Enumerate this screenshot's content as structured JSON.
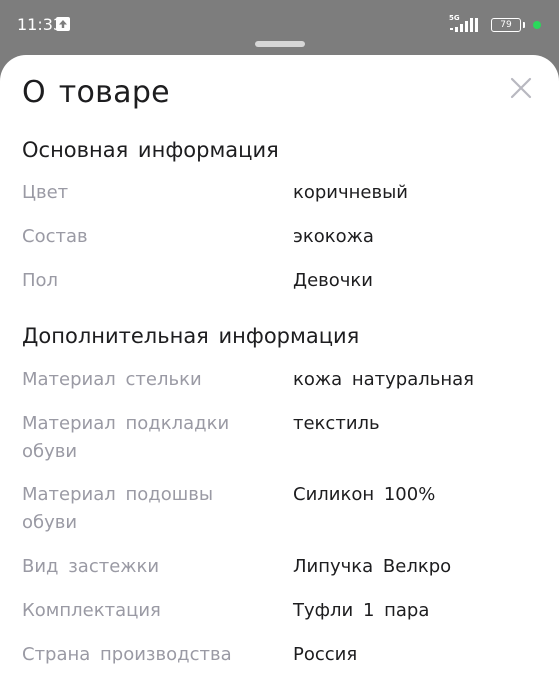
{
  "status_bar": {
    "time": "11:33",
    "network": "5G",
    "battery": "79"
  },
  "sheet": {
    "title": "О товаре",
    "sections": [
      {
        "heading": "Основная информация",
        "rows": [
          {
            "label": "Цвет",
            "value": "коричневый"
          },
          {
            "label": "Состав",
            "value": "экокожа"
          },
          {
            "label": "Пол",
            "value": "Девочки"
          }
        ]
      },
      {
        "heading": "Дополнительная информация",
        "rows": [
          {
            "label": "Материал стельки",
            "value": "кожа натуральная"
          },
          {
            "label": "Материал подкладки обуви",
            "value": "текстиль"
          },
          {
            "label": "Материал подошвы обуви",
            "value": "Силикон 100%"
          },
          {
            "label": "Вид застежки",
            "value": "Липучка Велкро"
          },
          {
            "label": "Комплектация",
            "value": "Туфли 1 пара"
          },
          {
            "label": "Страна производства",
            "value": "Россия"
          }
        ]
      }
    ]
  }
}
